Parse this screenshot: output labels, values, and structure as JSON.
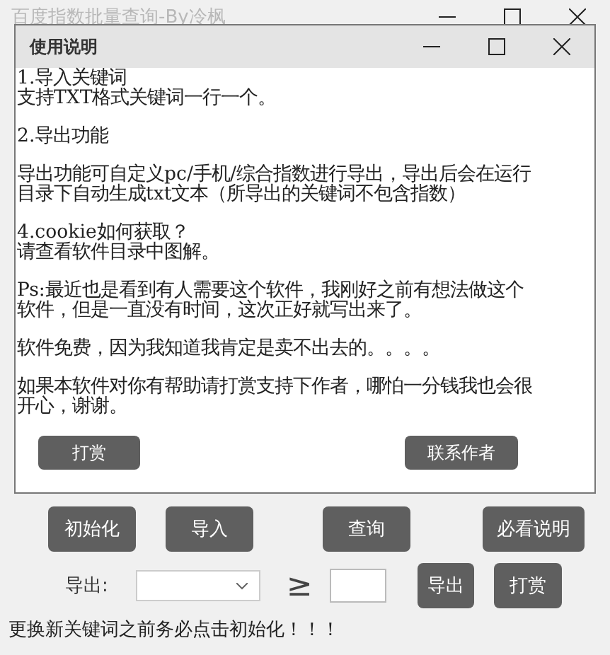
{
  "window": {
    "title": "百度指数批量查询-By冷枫"
  },
  "dialog": {
    "title": "使用说明",
    "paragraphs": [
      [
        "1.导入关键词",
        "支持TXT格式关键词一行一个。"
      ],
      [
        "2.导出功能"
      ],
      [
        "导出功能可自定义pc/手机/综合指数进行导出，导出后会在运行目录下自动生成txt文本（所导出的关键词不包含指数）"
      ],
      [
        "4.cookie如何获取？",
        "请查看软件目录中图解。"
      ],
      [
        "Ps:最近也是看到有人需要这个软件，我刚好之前有想法做这个软件，但是一直没有时间，这次正好就写出来了。"
      ],
      [
        "软件免费，因为我知道我肯定是卖不出去的。。。。"
      ],
      [
        "如果本软件对你有帮助请打赏支持下作者，哪怕一分钱我也会很开心，谢谢。"
      ]
    ],
    "buttons": [
      "打赏",
      "联系作者"
    ]
  },
  "main_buttons": [
    "初始化",
    "导入",
    "查询",
    "必看说明"
  ],
  "export": {
    "label": "导出:",
    "symbol": "≥",
    "buttons": [
      "导出",
      "打赏"
    ]
  },
  "footer": "更换新关键词之前务必点击初始化！！！"
}
